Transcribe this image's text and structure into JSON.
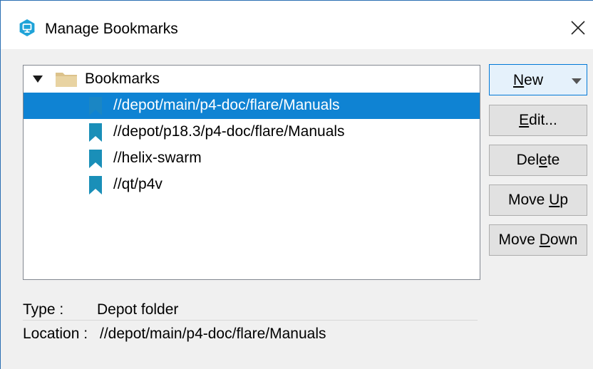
{
  "window": {
    "title": "Manage Bookmarks",
    "accent_color": "#0f83d3",
    "icon": "app-logo-icon"
  },
  "tree": {
    "root": {
      "label": "Bookmarks",
      "expanded": true,
      "icon": "folder-icon"
    },
    "items": [
      {
        "label": "//depot/main/p4-doc/flare/Manuals",
        "selected": true,
        "icon": "bookmark-icon"
      },
      {
        "label": "//depot/p18.3/p4-doc/flare/Manuals",
        "selected": false,
        "icon": "bookmark-icon"
      },
      {
        "label": "//helix-swarm",
        "selected": false,
        "icon": "bookmark-icon"
      },
      {
        "label": "//qt/p4v",
        "selected": false,
        "icon": "bookmark-icon"
      }
    ]
  },
  "buttons": {
    "new": {
      "pre": "",
      "key": "N",
      "post": "ew"
    },
    "edit": {
      "pre": "",
      "key": "E",
      "post": "dit..."
    },
    "delete": {
      "pre": "Del",
      "key": "e",
      "post": "te"
    },
    "move_up": {
      "pre": "Move ",
      "key": "U",
      "post": "p"
    },
    "move_down": {
      "pre": "Move ",
      "key": "D",
      "post": "own"
    }
  },
  "info": {
    "type_label": "Type :",
    "type_value": "Depot folder",
    "location_label": "Location :",
    "location_value": "//depot/main/p4-doc/flare/Manuals"
  }
}
